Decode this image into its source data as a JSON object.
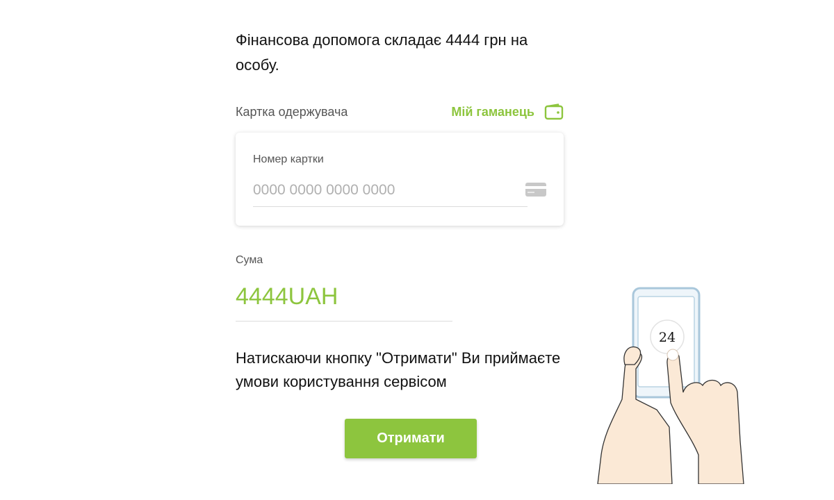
{
  "intro": {
    "text": "Фінансова допомога складає 4444 грн на особу."
  },
  "recipient": {
    "label": "Картка одержувача",
    "wallet_link": "Мій гаманець",
    "wallet_icon": "wallet-icon"
  },
  "card": {
    "label": "Номер картки",
    "value": "",
    "placeholder": "0000 0000 0000 0000",
    "icon": "credit-card-icon"
  },
  "amount": {
    "label": "Сума",
    "value": "4444UAH"
  },
  "terms": {
    "text": "Натискаючи кнопку \"Отримати\" Ви приймаєте умови користування сервісом"
  },
  "submit": {
    "label": "Отримати"
  },
  "illustration": {
    "badge": "24",
    "icon": "phone-in-hands-illustration"
  },
  "colors": {
    "accent": "#8dc53e",
    "text": "#111111",
    "muted": "#555555"
  }
}
